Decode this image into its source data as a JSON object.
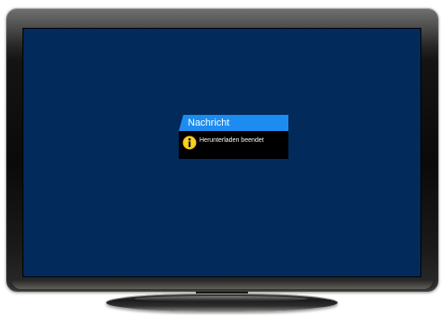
{
  "dialog": {
    "title": "Nachricht",
    "message": "Herunterladen beendet",
    "icon": "info-icon"
  },
  "colors": {
    "screen": "#022a5a",
    "dialog_header": "#1c8cf0",
    "dialog_body": "#000000",
    "info_icon": "#f2c100"
  }
}
